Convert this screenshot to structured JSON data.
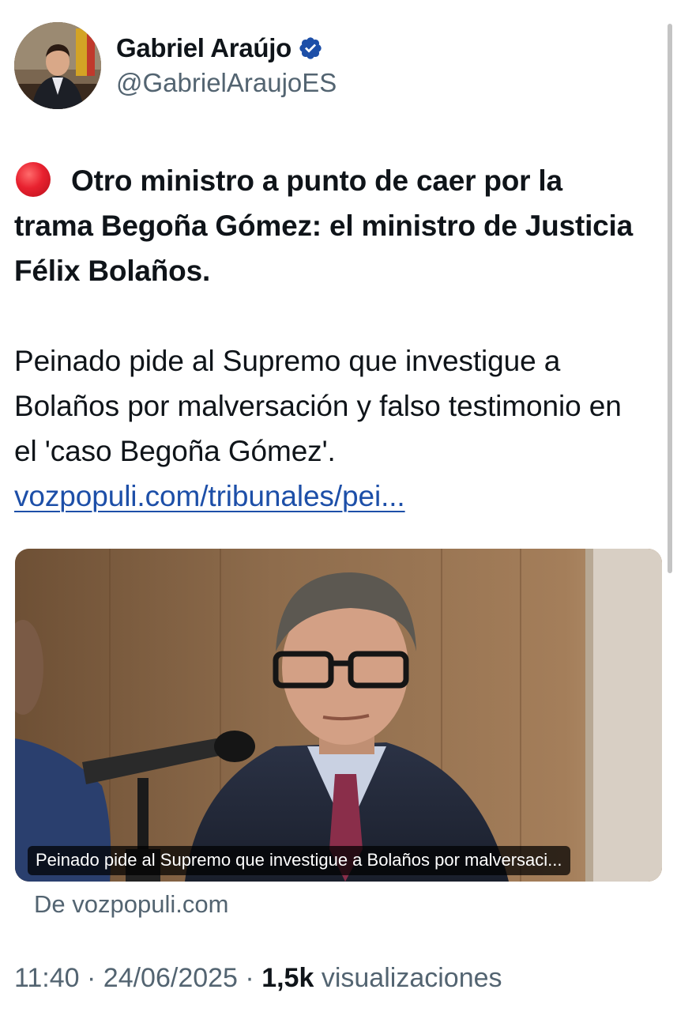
{
  "author": {
    "name": "Gabriel Araújo",
    "handle": "@GabrielAraujoES",
    "verified": true,
    "verified_icon": "verified-badge-icon",
    "verified_color": "#1d4fa8"
  },
  "tweet": {
    "headline": "Otro ministro a punto de caer por la trama Begoña Gómez: el ministro de Justicia Félix Bolaños.",
    "headline_emoji": "red-circle-icon",
    "description": "Peinado pide al Supremo que investigue a Bolaños por malversación y falso testimonio en el 'caso Begoña Gómez'.",
    "link_text": "vozpopuli.com/tribunales/pei..."
  },
  "card": {
    "caption": "Peinado pide al Supremo que investigue a Bolaños por malversaci...",
    "source": "De vozpopuli.com"
  },
  "meta": {
    "time": "11:40",
    "date": "24/06/2025",
    "separator": "·",
    "views_count": "1,5k",
    "views_label": "visualizaciones"
  },
  "colors": {
    "text": "#0f1419",
    "secondary": "#536471",
    "link": "#1d4fa8",
    "red_dot": "#e8212f"
  }
}
